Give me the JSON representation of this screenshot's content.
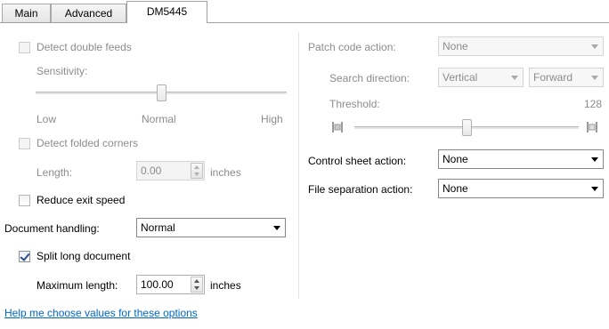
{
  "tabs": [
    {
      "label": "Main"
    },
    {
      "label": "Advanced"
    },
    {
      "label": "DM5445"
    }
  ],
  "left": {
    "detect_double_feeds": {
      "label": "Detect double feeds",
      "checked": false,
      "enabled": false
    },
    "sensitivity": {
      "label": "Sensitivity:",
      "low": "Low",
      "normal": "Normal",
      "high": "High",
      "level_fraction": 0.5
    },
    "detect_folded_corners": {
      "label": "Detect folded corners",
      "checked": false,
      "enabled": false
    },
    "length": {
      "label": "Length:",
      "value": "0.00",
      "unit": "inches"
    },
    "reduce_exit_speed": {
      "label": "Reduce exit speed",
      "checked": false
    },
    "document_handling": {
      "label": "Document handling:",
      "value": "Normal"
    },
    "split_long_document": {
      "label": "Split long document",
      "checked": true
    },
    "maximum_length": {
      "label": "Maximum length:",
      "value": "100.00",
      "unit": "inches"
    },
    "help_link": "Help me choose values for these options"
  },
  "right": {
    "patch_code_action": {
      "label": "Patch code action:",
      "value": "None"
    },
    "search_direction": {
      "label": "Search direction:",
      "orientation": "Vertical",
      "direction": "Forward"
    },
    "threshold": {
      "label": "Threshold:",
      "value": "128",
      "level_fraction": 0.5
    },
    "control_sheet_action": {
      "label": "Control sheet action:",
      "value": "None"
    },
    "file_separation_action": {
      "label": "File separation action:",
      "value": "None"
    }
  },
  "colors": {
    "link": "#0066cc",
    "disabled_text": "#8c8c8c",
    "check_mark": "#2a4d8f"
  }
}
